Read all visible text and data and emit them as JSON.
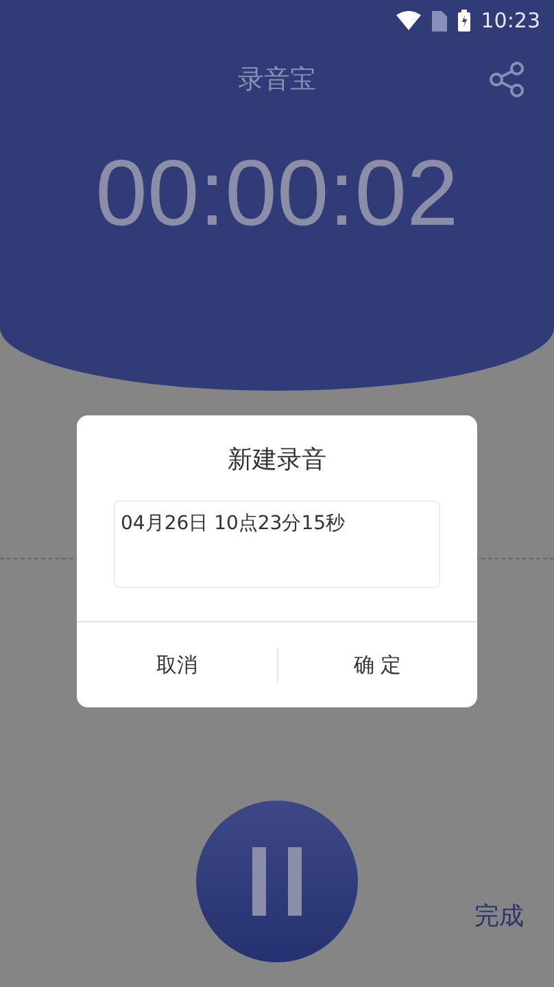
{
  "status_bar": {
    "time": "10:23"
  },
  "header": {
    "title": "录音宝"
  },
  "timer": "00:00:02",
  "dialog": {
    "title": "新建录音",
    "name_field": {
      "value": "04月26日 10点23分15秒"
    },
    "buttons": [
      "取消",
      "确 定"
    ]
  },
  "done_label": "完成"
}
